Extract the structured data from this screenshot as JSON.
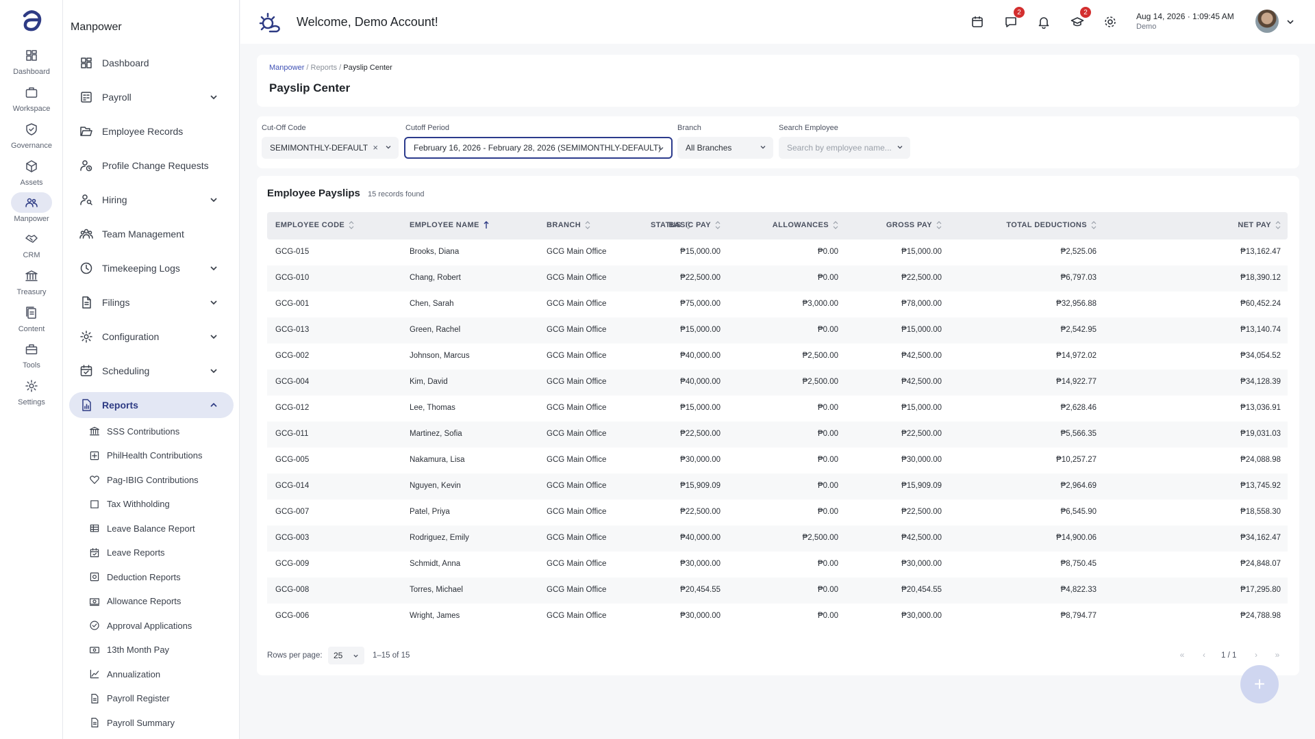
{
  "rail": [
    {
      "label": "Dashboard",
      "icon": "dashboard-grid-icon"
    },
    {
      "label": "Workspace",
      "icon": "briefcase-icon"
    },
    {
      "label": "Governance",
      "icon": "shield-check-icon"
    },
    {
      "label": "Assets",
      "icon": "cube-icon"
    },
    {
      "label": "Manpower",
      "icon": "people-icon"
    },
    {
      "label": "CRM",
      "icon": "handshake-icon"
    },
    {
      "label": "Treasury",
      "icon": "bank-icon"
    },
    {
      "label": "Content",
      "icon": "document-stack-icon"
    },
    {
      "label": "Tools",
      "icon": "toolbox-icon"
    },
    {
      "label": "Settings",
      "icon": "gear-icon"
    }
  ],
  "sidebar": {
    "title": "Manpower",
    "items": [
      {
        "label": "Dashboard",
        "icon": "dashboard-grid-icon"
      },
      {
        "label": "Payroll",
        "icon": "calculator-icon"
      },
      {
        "label": "Employee Records",
        "icon": "folder-open-icon"
      },
      {
        "label": "Profile Change Requests",
        "icon": "person-sync-icon"
      },
      {
        "label": "Hiring",
        "icon": "person-search-icon"
      },
      {
        "label": "Team Management",
        "icon": "team-icon"
      },
      {
        "label": "Timekeeping Logs",
        "icon": "clock-icon"
      },
      {
        "label": "Filings",
        "icon": "file-icon"
      },
      {
        "label": "Configuration",
        "icon": "gear-icon"
      },
      {
        "label": "Scheduling",
        "icon": "calendar-icon"
      },
      {
        "label": "Reports",
        "icon": "report-icon"
      }
    ],
    "reports_sub": [
      {
        "label": "SSS Contributions",
        "icon": "bank-icon"
      },
      {
        "label": "PhilHealth Contributions",
        "icon": "medical-plus-icon"
      },
      {
        "label": "Pag-IBIG Contributions",
        "icon": "heart-icon"
      },
      {
        "label": "Tax Withholding",
        "icon": "square-icon"
      },
      {
        "label": "Leave Balance Report",
        "icon": "table-icon"
      },
      {
        "label": "Leave Reports",
        "icon": "calendar-check-icon"
      },
      {
        "label": "Deduction Reports",
        "icon": "minus-doc-icon"
      },
      {
        "label": "Allowance Reports",
        "icon": "money-icon"
      },
      {
        "label": "Approval Applications",
        "icon": "check-circle-icon"
      },
      {
        "label": "13th Month Pay",
        "icon": "cash-icon"
      },
      {
        "label": "Annualization",
        "icon": "line-chart-icon"
      },
      {
        "label": "Payroll Register",
        "icon": "document-icon"
      },
      {
        "label": "Payroll Summary",
        "icon": "document-icon"
      }
    ]
  },
  "header": {
    "welcome": "Welcome, Demo Account!",
    "messages_badge": "2",
    "learning_badge": "2",
    "date": "Aug 14, 2026 · 1:09:45 AM",
    "user": "Demo"
  },
  "breadcrumb": {
    "root": "Manpower",
    "mid": "Reports",
    "current": "Payslip Center",
    "sep": "/"
  },
  "page_title": "Payslip Center",
  "filters": {
    "cutoff_code": {
      "label": "Cut-Off Code",
      "value": "SEMIMONTHLY-DEFAULT",
      "clear": "×"
    },
    "cutoff_period": {
      "label": "Cutoff Period",
      "value": "February 16, 2026 - February 28, 2026 (SEMIMONTHLY-DEFAULT)"
    },
    "branch": {
      "label": "Branch",
      "value": "All Branches"
    },
    "search": {
      "label": "Search Employee",
      "placeholder": "Search by employee name..."
    }
  },
  "table": {
    "title": "Employee Payslips",
    "count": "15 records found",
    "columns": [
      "EMPLOYEE CODE",
      "EMPLOYEE NAME",
      "BRANCH",
      "STATUS",
      "BASIC PAY",
      "ALLOWANCES",
      "GROSS PAY",
      "TOTAL DEDUCTIONS",
      "NET PAY"
    ],
    "rows": [
      [
        "GCG-015",
        "Brooks, Diana",
        "GCG Main Office",
        "",
        "₱15,000.00",
        "₱0.00",
        "₱15,000.00",
        "₱2,525.06",
        "₱13,162.47"
      ],
      [
        "GCG-010",
        "Chang, Robert",
        "GCG Main Office",
        "",
        "₱22,500.00",
        "₱0.00",
        "₱22,500.00",
        "₱6,797.03",
        "₱18,390.12"
      ],
      [
        "GCG-001",
        "Chen, Sarah",
        "GCG Main Office",
        "",
        "₱75,000.00",
        "₱3,000.00",
        "₱78,000.00",
        "₱32,956.88",
        "₱60,452.24"
      ],
      [
        "GCG-013",
        "Green, Rachel",
        "GCG Main Office",
        "",
        "₱15,000.00",
        "₱0.00",
        "₱15,000.00",
        "₱2,542.95",
        "₱13,140.74"
      ],
      [
        "GCG-002",
        "Johnson, Marcus",
        "GCG Main Office",
        "",
        "₱40,000.00",
        "₱2,500.00",
        "₱42,500.00",
        "₱14,972.02",
        "₱34,054.52"
      ],
      [
        "GCG-004",
        "Kim, David",
        "GCG Main Office",
        "",
        "₱40,000.00",
        "₱2,500.00",
        "₱42,500.00",
        "₱14,922.77",
        "₱34,128.39"
      ],
      [
        "GCG-012",
        "Lee, Thomas",
        "GCG Main Office",
        "",
        "₱15,000.00",
        "₱0.00",
        "₱15,000.00",
        "₱2,628.46",
        "₱13,036.91"
      ],
      [
        "GCG-011",
        "Martinez, Sofia",
        "GCG Main Office",
        "",
        "₱22,500.00",
        "₱0.00",
        "₱22,500.00",
        "₱5,566.35",
        "₱19,031.03"
      ],
      [
        "GCG-005",
        "Nakamura, Lisa",
        "GCG Main Office",
        "",
        "₱30,000.00",
        "₱0.00",
        "₱30,000.00",
        "₱10,257.27",
        "₱24,088.98"
      ],
      [
        "GCG-014",
        "Nguyen, Kevin",
        "GCG Main Office",
        "",
        "₱15,909.09",
        "₱0.00",
        "₱15,909.09",
        "₱2,964.69",
        "₱13,745.92"
      ],
      [
        "GCG-007",
        "Patel, Priya",
        "GCG Main Office",
        "",
        "₱22,500.00",
        "₱0.00",
        "₱22,500.00",
        "₱6,545.90",
        "₱18,558.30"
      ],
      [
        "GCG-003",
        "Rodriguez, Emily",
        "GCG Main Office",
        "",
        "₱40,000.00",
        "₱2,500.00",
        "₱42,500.00",
        "₱14,900.06",
        "₱34,162.47"
      ],
      [
        "GCG-009",
        "Schmidt, Anna",
        "GCG Main Office",
        "",
        "₱30,000.00",
        "₱0.00",
        "₱30,000.00",
        "₱8,750.45",
        "₱24,848.07"
      ],
      [
        "GCG-008",
        "Torres, Michael",
        "GCG Main Office",
        "",
        "₱20,454.55",
        "₱0.00",
        "₱20,454.55",
        "₱4,822.33",
        "₱17,295.80"
      ],
      [
        "GCG-006",
        "Wright, James",
        "GCG Main Office",
        "",
        "₱30,000.00",
        "₱0.00",
        "₱30,000.00",
        "₱8,794.77",
        "₱24,788.98"
      ]
    ]
  },
  "pagination": {
    "rows_label": "Rows per page:",
    "rows_value": "25",
    "range": "1–15 of 15",
    "page": "1 / 1",
    "first": "«",
    "prev": "‹",
    "next": "›",
    "last": "»"
  },
  "fab_label": "+",
  "colors": {
    "accent": "#2e3b84",
    "active_bg": "#e3e7f4",
    "badge": "#d32f2f",
    "link": "#3f51b5"
  }
}
